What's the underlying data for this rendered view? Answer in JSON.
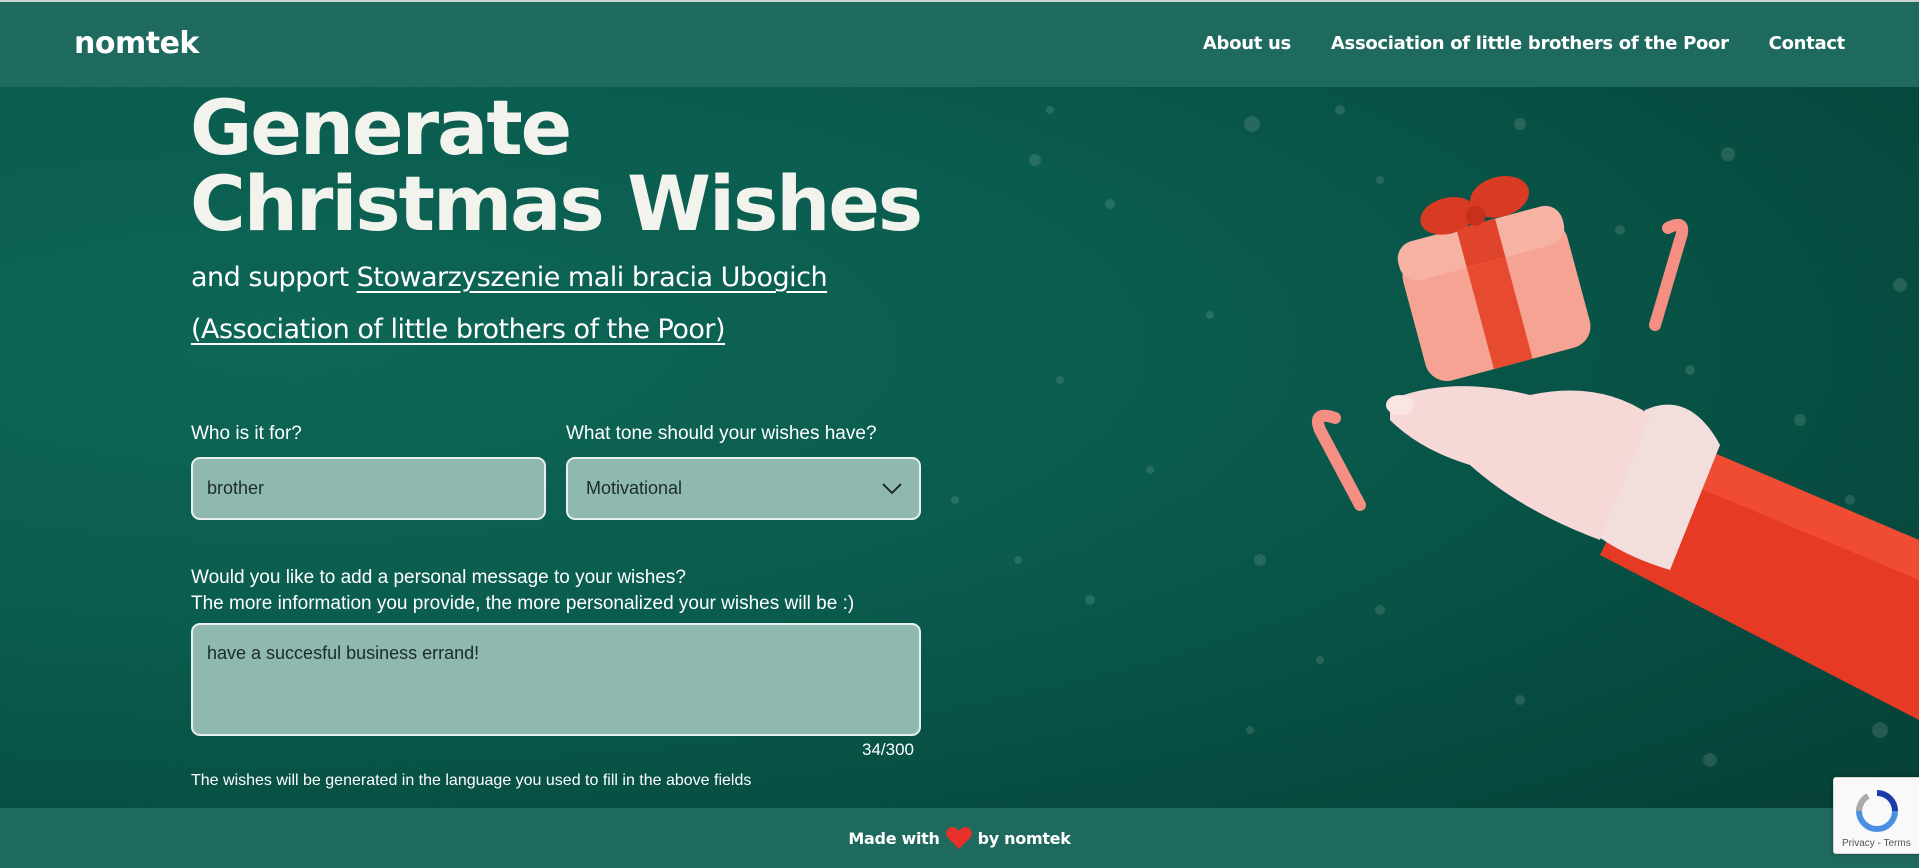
{
  "header": {
    "logo": "nomtek",
    "nav": [
      "About us",
      "Association of little brothers of the Poor",
      "Contact"
    ]
  },
  "hero": {
    "title_line1": "Generate",
    "title_line2": "Christmas Wishes",
    "subtitle_prefix": "and support ",
    "subtitle_link": "Stowarzyszenie mali bracia Ubogich (Association of little brothers of the Poor)"
  },
  "form": {
    "recipient_label": "Who is it for?",
    "recipient_value": "brother",
    "tone_label": "What tone should your wishes have?",
    "tone_value": "Motivational",
    "message_label_line1": "Would you like to add a personal message to your wishes?",
    "message_label_line2": "The more information you provide, the more personalized your wishes will be :)",
    "message_value": "have a succesful business errand!",
    "counter": "34/300",
    "language_note": "The wishes will be generated in the language you used to fill in the above fields"
  },
  "footer": {
    "prefix": "Made with",
    "suffix": "by nomtek"
  },
  "recaptcha": {
    "terms": "Privacy - Terms"
  },
  "colors": {
    "background": "#0a5c4e",
    "header": "#1f6a5e",
    "field": "#8fb9b0",
    "heart": "#e8312b"
  },
  "icons": [
    "chevron-down-icon",
    "heart-icon",
    "recaptcha-icon"
  ]
}
